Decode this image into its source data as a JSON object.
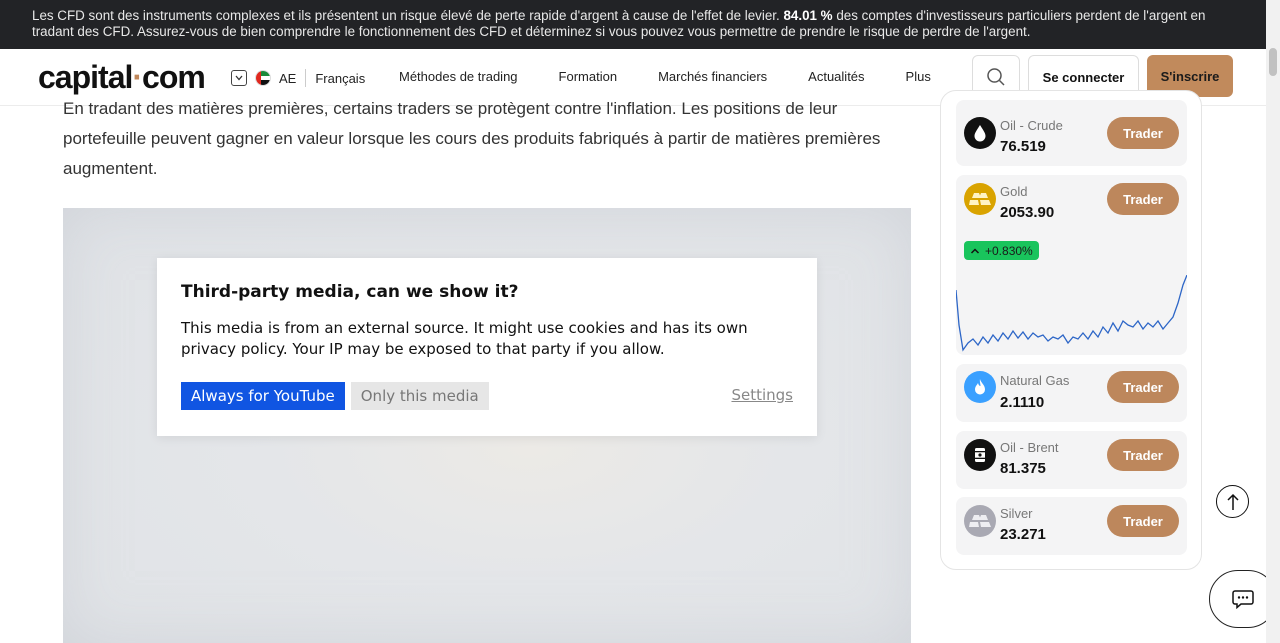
{
  "risk_banner": {
    "text_before": "Les CFD sont des instruments complexes et ils présentent un risque élevé de perte rapide d'argent à cause de l'effet de levier. ",
    "percent": "84.01 %",
    "text_after": " des comptes d'investisseurs particuliers perdent de l'argent en tradant des CFD. Assurez-vous de bien comprendre le fonctionnement des CFD et déterminez si vous pouvez vous permettre de prendre le risque de perdre de l'argent."
  },
  "header": {
    "logo_main": "capital",
    "logo_dot": "·",
    "logo_tld": "com",
    "region_code": "AE",
    "language": "Français",
    "nav": [
      "Méthodes de trading",
      "Formation",
      "Marchés financiers",
      "Actualités",
      "Plus"
    ],
    "login_label": "Se connecter",
    "signup_label": "S'inscrire"
  },
  "article": {
    "paragraph": "En tradant des matières premières, certains traders se protègent contre l'inflation. Les positions de leur portefeuille peuvent gagner en valeur lorsque les cours des produits fabriqués à partir de matières premières augmentent."
  },
  "consent": {
    "title": "Third-party media, can we show it?",
    "body": "This media is from an external source. It might use cookies and has its own privacy policy. Your IP may be exposed to that party if you allow.",
    "always_label": "Always for YouTube",
    "once_label": "Only this media",
    "settings_label": "Settings"
  },
  "markets": [
    {
      "name": "Oil - Crude",
      "price": "76.519",
      "trade_label": "Trader",
      "icon": "oil-drop-icon",
      "icon_bg": "#111111"
    },
    {
      "name": "Gold",
      "price": "2053.90",
      "trade_label": "Trader",
      "icon": "gold-bars-icon",
      "icon_bg": "#d9a300",
      "change": "+0.830%"
    },
    {
      "name": "Natural Gas",
      "price": "2.1110",
      "trade_label": "Trader",
      "icon": "flame-icon",
      "icon_bg": "#3aa0ff"
    },
    {
      "name": "Oil - Brent",
      "price": "81.375",
      "trade_label": "Trader",
      "icon": "oil-barrel-icon",
      "icon_bg": "#111111"
    },
    {
      "name": "Silver",
      "price": "23.271",
      "trade_label": "Trader",
      "icon": "silver-bars-icon",
      "icon_bg": "#a9a9b3"
    }
  ],
  "colors": {
    "accent": "#c18a5c",
    "consent_primary": "#1055e2",
    "positive": "#19c45c",
    "sparkline": "#2d66c7"
  }
}
